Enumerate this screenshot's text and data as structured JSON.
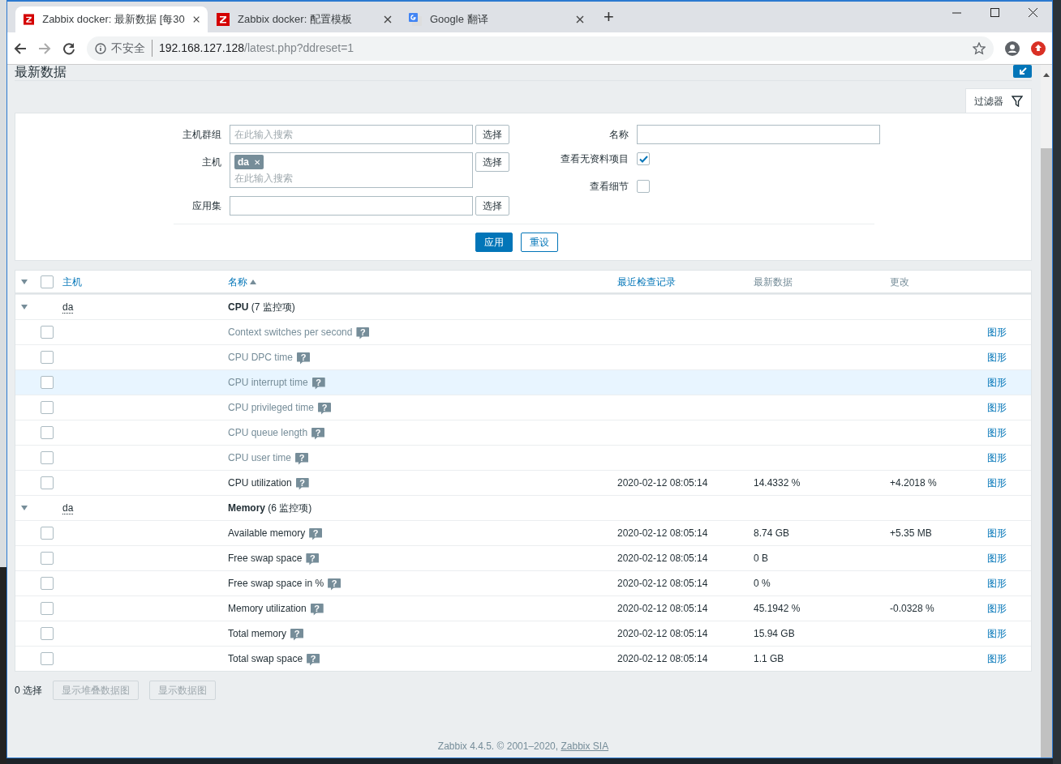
{
  "browser": {
    "tabs": [
      {
        "kind": "zabbix",
        "title": "Zabbix docker: 最新数据 [每30",
        "selected": true
      },
      {
        "kind": "zabbix",
        "title": "Zabbix docker: 配置模板",
        "selected": false
      },
      {
        "kind": "google",
        "title": "Google 翻译",
        "selected": false
      }
    ],
    "new_tab": "+",
    "address": {
      "security": "不安全",
      "host": "192.168.127.128",
      "path": "/latest.php?ddreset=1"
    }
  },
  "page": {
    "title": "最新数据",
    "filter_tab": "过滤器",
    "filter": {
      "left": [
        {
          "kind": "search",
          "label": "主机群组",
          "placeholder": "在此输入搜索",
          "button": "选择"
        },
        {
          "kind": "multi",
          "label": "主机",
          "tags": [
            {
              "text": "da",
              "remove": "✕"
            }
          ],
          "placeholder": "在此输入搜索",
          "button": "选择"
        },
        {
          "kind": "text",
          "label": "应用集",
          "button": "选择"
        }
      ],
      "right": [
        {
          "kind": "text",
          "label": "名称"
        },
        {
          "kind": "checkbox",
          "label": "查看无资料项目",
          "checked": true
        },
        {
          "kind": "checkbox",
          "label": "查看细节",
          "checked": false
        }
      ],
      "apply": "应用",
      "reset": "重设"
    },
    "table": {
      "expanded": true,
      "all_selected": false,
      "columns": [
        {
          "label": "主机",
          "link": true,
          "sorted": false
        },
        {
          "label": "名称",
          "link": true,
          "sorted": true
        },
        {
          "label": "最近检查记录",
          "link": true,
          "sorted": false
        },
        {
          "label": "最新数据",
          "link": false,
          "sorted": false
        },
        {
          "label": "更改",
          "link": false,
          "sorted": false
        }
      ],
      "groups": [
        {
          "host": "da",
          "name": "**CPU** (7 监控项)",
          "expanded": true,
          "rows": [
            {
              "name": "Context switches per second",
              "help": "?",
              "no_data": true,
              "hovered": false,
              "selected": false,
              "link": "图形"
            },
            {
              "name": "CPU DPC time",
              "help": "?",
              "no_data": true,
              "hovered": false,
              "selected": false,
              "link": "图形"
            },
            {
              "name": "CPU interrupt time",
              "help": "?",
              "no_data": true,
              "hovered": true,
              "selected": false,
              "link": "图形"
            },
            {
              "name": "CPU privileged time",
              "help": "?",
              "no_data": true,
              "hovered": false,
              "selected": false,
              "link": "图形"
            },
            {
              "name": "CPU queue length",
              "help": "?",
              "no_data": true,
              "hovered": false,
              "selected": false,
              "link": "图形"
            },
            {
              "name": "CPU user time",
              "help": "?",
              "no_data": true,
              "hovered": false,
              "selected": false,
              "link": "图形"
            },
            {
              "name": "CPU utilization",
              "help": "?",
              "no_data": false,
              "hovered": false,
              "selected": false,
              "last_check": "2020-02-12 08:05:14",
              "last_value": "14.4332 %",
              "change": "+4.2018 %",
              "link": "图形"
            }
          ]
        },
        {
          "host": "da",
          "name": "**Memory** (6 监控项)",
          "expanded": true,
          "rows": [
            {
              "name": "Available memory",
              "help": "?",
              "no_data": false,
              "hovered": false,
              "selected": false,
              "last_check": "2020-02-12 08:05:14",
              "last_value": "8.74 GB",
              "change": "+5.35 MB",
              "link": "图形"
            },
            {
              "name": "Free swap space",
              "help": "?",
              "no_data": false,
              "hovered": false,
              "selected": false,
              "last_check": "2020-02-12 08:05:14",
              "last_value": "0 B",
              "link": "图形"
            },
            {
              "name": "Free swap space in %",
              "help": "?",
              "no_data": false,
              "hovered": false,
              "selected": false,
              "last_check": "2020-02-12 08:05:14",
              "last_value": "0 %",
              "link": "图形"
            },
            {
              "name": "Memory utilization",
              "help": "?",
              "no_data": false,
              "hovered": false,
              "selected": false,
              "last_check": "2020-02-12 08:05:14",
              "last_value": "45.1942 %",
              "change": "-0.0328 %",
              "link": "图形"
            },
            {
              "name": "Total memory",
              "help": "?",
              "no_data": false,
              "hovered": false,
              "selected": false,
              "last_check": "2020-02-12 08:05:14",
              "last_value": "15.94 GB",
              "link": "图形"
            },
            {
              "name": "Total swap space",
              "help": "?",
              "no_data": false,
              "hovered": false,
              "selected": false,
              "last_check": "2020-02-12 08:05:14",
              "last_value": "1.1 GB",
              "link": "图形"
            }
          ]
        }
      ]
    },
    "actions": {
      "count": "0 选择",
      "buttons": [
        {
          "label": "显示堆叠数据图",
          "disabled": true
        },
        {
          "label": "显示数据图",
          "disabled": true
        }
      ]
    },
    "footer": {
      "text": "Zabbix 4.4.5. © 2001–2020, ",
      "link": "Zabbix SIA"
    }
  }
}
